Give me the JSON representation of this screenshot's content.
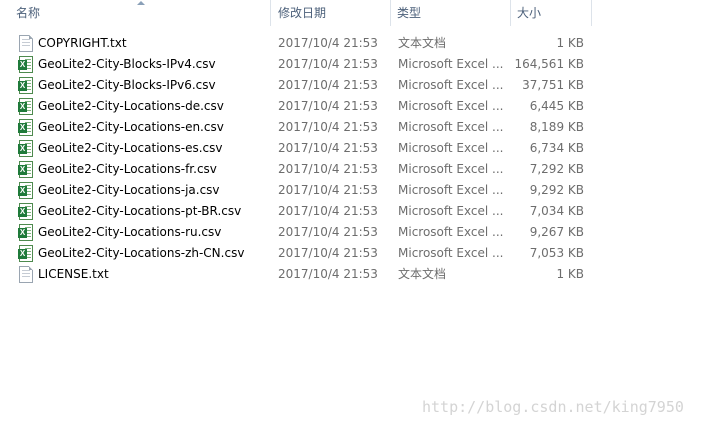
{
  "columns": {
    "name": "名称",
    "date": "修改日期",
    "type": "类型",
    "size": "大小"
  },
  "files": [
    {
      "name": "COPYRIGHT.txt",
      "date": "2017/10/4 21:53",
      "type": "文本文档",
      "size": "1 KB",
      "icon": "text-file-icon"
    },
    {
      "name": "GeoLite2-City-Blocks-IPv4.csv",
      "date": "2017/10/4 21:53",
      "type": "Microsoft Excel ...",
      "size": "164,561 KB",
      "icon": "excel-file-icon"
    },
    {
      "name": "GeoLite2-City-Blocks-IPv6.csv",
      "date": "2017/10/4 21:53",
      "type": "Microsoft Excel ...",
      "size": "37,751 KB",
      "icon": "excel-file-icon"
    },
    {
      "name": "GeoLite2-City-Locations-de.csv",
      "date": "2017/10/4 21:53",
      "type": "Microsoft Excel ...",
      "size": "6,445 KB",
      "icon": "excel-file-icon"
    },
    {
      "name": "GeoLite2-City-Locations-en.csv",
      "date": "2017/10/4 21:53",
      "type": "Microsoft Excel ...",
      "size": "8,189 KB",
      "icon": "excel-file-icon"
    },
    {
      "name": "GeoLite2-City-Locations-es.csv",
      "date": "2017/10/4 21:53",
      "type": "Microsoft Excel ...",
      "size": "6,734 KB",
      "icon": "excel-file-icon"
    },
    {
      "name": "GeoLite2-City-Locations-fr.csv",
      "date": "2017/10/4 21:53",
      "type": "Microsoft Excel ...",
      "size": "7,292 KB",
      "icon": "excel-file-icon"
    },
    {
      "name": "GeoLite2-City-Locations-ja.csv",
      "date": "2017/10/4 21:53",
      "type": "Microsoft Excel ...",
      "size": "9,292 KB",
      "icon": "excel-file-icon"
    },
    {
      "name": "GeoLite2-City-Locations-pt-BR.csv",
      "date": "2017/10/4 21:53",
      "type": "Microsoft Excel ...",
      "size": "7,034 KB",
      "icon": "excel-file-icon"
    },
    {
      "name": "GeoLite2-City-Locations-ru.csv",
      "date": "2017/10/4 21:53",
      "type": "Microsoft Excel ...",
      "size": "9,267 KB",
      "icon": "excel-file-icon"
    },
    {
      "name": "GeoLite2-City-Locations-zh-CN.csv",
      "date": "2017/10/4 21:53",
      "type": "Microsoft Excel ...",
      "size": "7,053 KB",
      "icon": "excel-file-icon"
    },
    {
      "name": "LICENSE.txt",
      "date": "2017/10/4 21:53",
      "type": "文本文档",
      "size": "1 KB",
      "icon": "text-file-icon"
    }
  ],
  "watermark": "http://blog.csdn.net/king7950",
  "colors": {
    "header_text": "#4c607a",
    "secondary_text": "#6d6d6d",
    "excel_green": "#1f7a3a",
    "watermark": "#d4d4d4"
  }
}
